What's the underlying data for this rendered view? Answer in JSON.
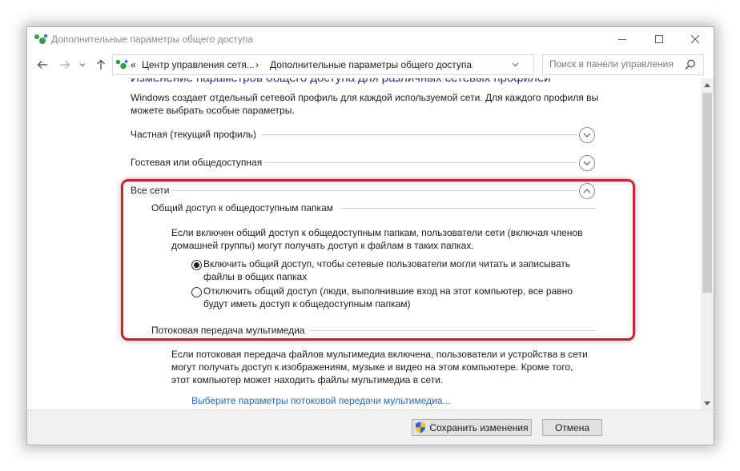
{
  "window": {
    "title": "Дополнительные параметры общего доступа"
  },
  "nav": {
    "breadcrumb_prefix": "«",
    "breadcrumb_parent": "Центр управления сетя...",
    "breadcrumb_separator": "›",
    "breadcrumb_current": "Дополнительные параметры общего доступа",
    "search_placeholder": "Поиск в панели управления"
  },
  "content": {
    "heading": "Изменение параметров общего доступа для различных сетевых профилей",
    "intro_line1": "Windows создает отдельный сетевой профиль для каждой используемой сети. Для каждого профиля вы",
    "intro_line2": "можете выбрать особые параметры.",
    "profiles": [
      {
        "label": "Частная (текущий профиль)",
        "expanded": false
      },
      {
        "label": "Гостевая или общедоступная",
        "expanded": false
      },
      {
        "label": "Все сети",
        "expanded": true
      }
    ],
    "public_folders": {
      "title": "Общий доступ к общедоступным папкам",
      "desc_line1": "Если включен общий доступ к общедоступным папкам, пользователи сети (включая членов",
      "desc_line2": "домашней группы) могут получать доступ к файлам в таких папках.",
      "options": [
        {
          "line1": "Включить общий доступ, чтобы сетевые пользователи могли читать и записывать",
          "line2": "файлы в общих папках",
          "selected": true
        },
        {
          "line1": "Отключить общий доступ (люди, выполнившие вход на этот компьютер, все равно",
          "line2": "будут иметь доступ к общедоступным папкам)",
          "selected": false
        }
      ]
    },
    "media_streaming": {
      "title": "Потоковая передача мультимедиа",
      "desc_line1": "Если потоковая передача файлов мультимедиа включена, пользователи и устройства в сети",
      "desc_line2": "могут получать доступ к изображениям, музыке и видео на этом компьютере. Кроме того,",
      "desc_line3": "этот компьютер может находить файлы мультимедиа в сети.",
      "link": "Выберите параметры потоковой передачи мультимедиа..."
    }
  },
  "footer": {
    "save_label": "Сохранить изменения",
    "cancel_label": "Отмена"
  },
  "colors": {
    "heading": "#1e3287",
    "link": "#2a6ab3",
    "highlight": "#d0202b"
  }
}
